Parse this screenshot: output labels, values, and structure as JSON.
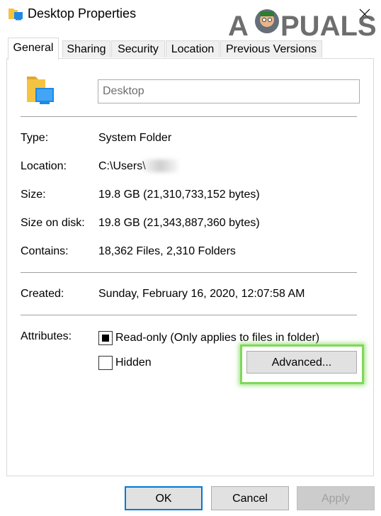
{
  "window": {
    "title": "Desktop Properties",
    "watermark": "A PUALS"
  },
  "tabs": [
    {
      "label": "General",
      "active": true
    },
    {
      "label": "Sharing",
      "active": false
    },
    {
      "label": "Security",
      "active": false
    },
    {
      "label": "Location",
      "active": false
    },
    {
      "label": "Previous Versions",
      "active": false
    }
  ],
  "general": {
    "name_value": "Desktop",
    "rows": {
      "type": {
        "label": "Type:",
        "value": "System Folder"
      },
      "location": {
        "label": "Location:",
        "value": "C:\\Users\\"
      },
      "size": {
        "label": "Size:",
        "value": "19.8 GB (21,310,733,152 bytes)"
      },
      "size_on_disk": {
        "label": "Size on disk:",
        "value": "19.8 GB (21,343,887,360 bytes)"
      },
      "contains": {
        "label": "Contains:",
        "value": "18,362 Files, 2,310 Folders"
      },
      "created": {
        "label": "Created:",
        "value": "Sunday, February 16, 2020, 12:07:58 AM"
      }
    },
    "attributes": {
      "label": "Attributes:",
      "readonly": {
        "label": "Read-only (Only applies to files in folder)",
        "state": "indeterminate"
      },
      "hidden": {
        "label": "Hidden",
        "state": "unchecked"
      },
      "advanced_label": "Advanced..."
    }
  },
  "footer": {
    "ok": "OK",
    "cancel": "Cancel",
    "apply": "Apply"
  },
  "colors": {
    "highlight": "#7ed957",
    "ok_border": "#0078d7"
  }
}
